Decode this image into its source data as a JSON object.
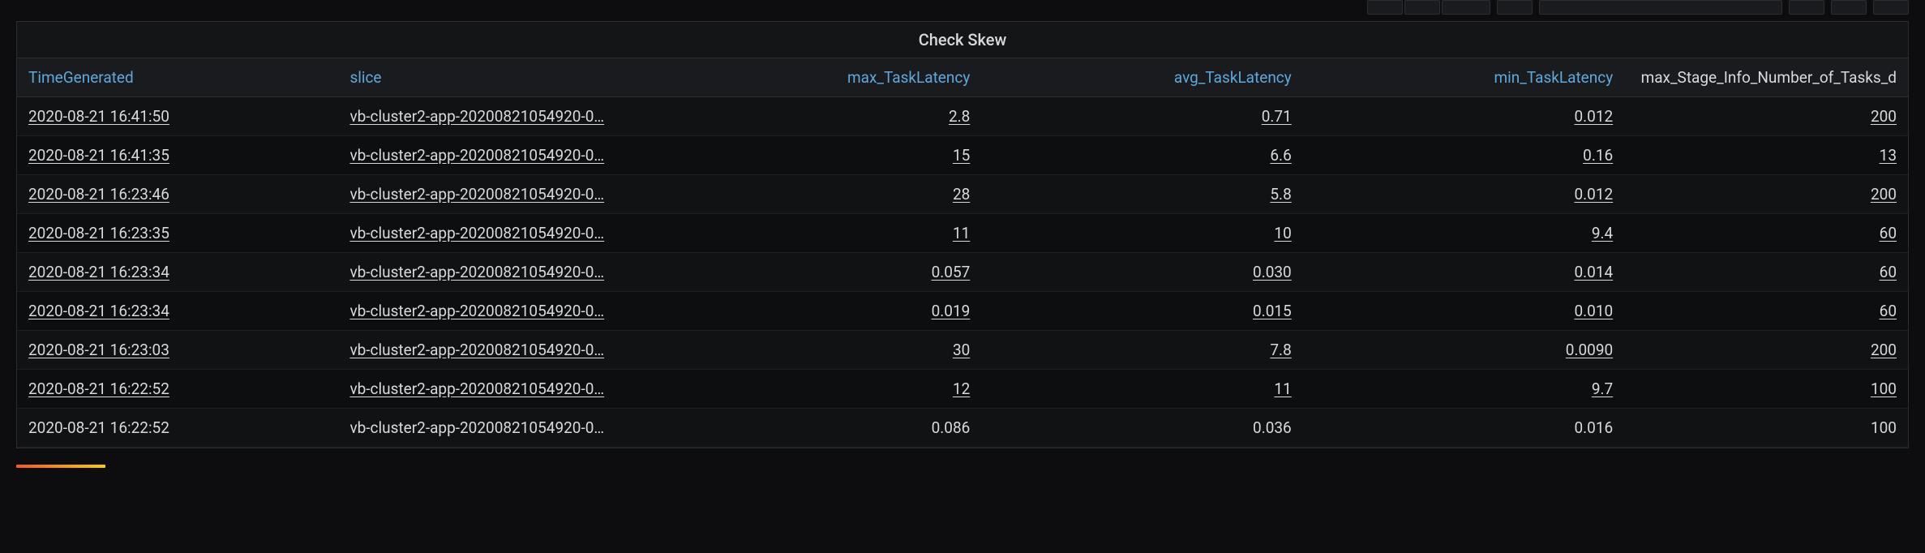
{
  "panel": {
    "title": "Check Skew"
  },
  "columns": {
    "time": "TimeGenerated",
    "slice": "slice",
    "max": "max_TaskLatency",
    "avg": "avg_TaskLatency",
    "min": "min_TaskLatency",
    "stage": "max_Stage_Info_Number_of_Tasks_d"
  },
  "rows": [
    {
      "time": "2020-08-21 16:41:50",
      "slice": "vb-cluster2-app-20200821054920-0…",
      "max": "2.8",
      "avg": "0.71",
      "min": "0.012",
      "stage": "200",
      "link": true
    },
    {
      "time": "2020-08-21 16:41:35",
      "slice": "vb-cluster2-app-20200821054920-0…",
      "max": "15",
      "avg": "6.6",
      "min": "0.16",
      "stage": "13",
      "link": true
    },
    {
      "time": "2020-08-21 16:23:46",
      "slice": "vb-cluster2-app-20200821054920-0…",
      "max": "28",
      "avg": "5.8",
      "min": "0.012",
      "stage": "200",
      "link": true
    },
    {
      "time": "2020-08-21 16:23:35",
      "slice": "vb-cluster2-app-20200821054920-0…",
      "max": "11",
      "avg": "10",
      "min": "9.4",
      "stage": "60",
      "link": true
    },
    {
      "time": "2020-08-21 16:23:34",
      "slice": "vb-cluster2-app-20200821054920-0…",
      "max": "0.057",
      "avg": "0.030",
      "min": "0.014",
      "stage": "60",
      "link": true
    },
    {
      "time": "2020-08-21 16:23:34",
      "slice": "vb-cluster2-app-20200821054920-0…",
      "max": "0.019",
      "avg": "0.015",
      "min": "0.010",
      "stage": "60",
      "link": true
    },
    {
      "time": "2020-08-21 16:23:03",
      "slice": "vb-cluster2-app-20200821054920-0…",
      "max": "30",
      "avg": "7.8",
      "min": "0.0090",
      "stage": "200",
      "link": true
    },
    {
      "time": "2020-08-21 16:22:52",
      "slice": "vb-cluster2-app-20200821054920-0…",
      "max": "12",
      "avg": "11",
      "min": "9.7",
      "stage": "100",
      "link": true
    },
    {
      "time": "2020-08-21 16:22:52",
      "slice": "vb-cluster2-app-20200821054920-0…",
      "max": "0.086",
      "avg": "0.036",
      "min": "0.016",
      "stage": "100",
      "link": false
    }
  ]
}
